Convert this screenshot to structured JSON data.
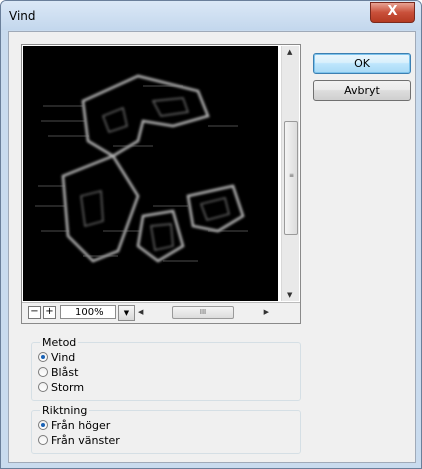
{
  "window": {
    "title": "Vind",
    "close_label": "X"
  },
  "buttons": {
    "ok": "OK",
    "cancel": "Avbryt"
  },
  "preview": {
    "zoom_out": "−",
    "zoom_in": "+",
    "zoom_value": "100%",
    "hscroll_grip": "III",
    "vscroll_grip": "≡"
  },
  "method": {
    "title": "Metod",
    "options": [
      "Vind",
      "Blåst",
      "Storm"
    ],
    "selected": "Vind"
  },
  "direction": {
    "title": "Riktning",
    "options": [
      "Från höger",
      "Från vänster"
    ],
    "selected": "Från höger"
  },
  "colors": {
    "title_bg": "#c9dbee",
    "close_red": "#c9503a",
    "accent_blue": "#1a62b5"
  }
}
